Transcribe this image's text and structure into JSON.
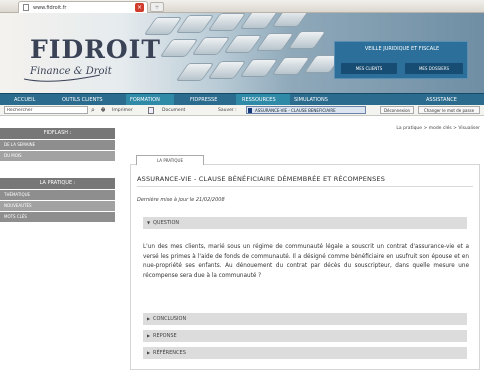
{
  "browser": {
    "tab_title": "www.fidroit.fr"
  },
  "brand": {
    "logo": "FIDROIT",
    "tagline": "Finance & Droit"
  },
  "veille": {
    "title": "VEILLE JURIDIQUE ET FISCALE",
    "btn_clients": "MES CLIENTS",
    "btn_dossiers": "MES DOSSIERS"
  },
  "nav": {
    "accueil": "ACCUEIL",
    "outils": "OUTILS CLIENTS",
    "formation": "FORMATION",
    "fidpresse": "FIDPRESSE",
    "ressources": "RESSOURCES",
    "simulations": "SIMULATIONS",
    "assistance": "ASSISTANCE"
  },
  "toolbar": {
    "search_value": "Rechercher",
    "imprimer": "Imprimer",
    "document": "Document",
    "sauver": "Sauver :",
    "sauver_value": "ASSURANCE-VIE - CLAUSE BENEFICIAIRE",
    "deconnexion": "Déconnexion",
    "changer": "Changer le mot de passe"
  },
  "sidebar": {
    "flash_title": "FIDFLASH :",
    "flash_items": [
      "DE LA SEMAINE",
      "DU MOIS"
    ],
    "pratique_title": "LA PRATIQUE :",
    "pratique_items": [
      "THÉMATIQUE",
      "NOUVEAUTÉS",
      "MOTS CLÉS"
    ]
  },
  "breadcrumb": "La pratique > mode clés > Visualiser",
  "content_tab": "LA PRATIQUE",
  "article": {
    "title": "ASSURANCE-VIE - CLAUSE BÉNÉFICIAIRE DÉMEMBRÉE ET RÉCOMPENSES",
    "date": "Dernière mise à jour le 21/02/2008",
    "sections": {
      "question": "QUESTION",
      "conclusion": "CONCLUSION",
      "reponse": "REPONSE",
      "references": "RÉFÉRENCES"
    },
    "question_text": "L'un des mes clients, marié sous un régime de communauté légale a souscrit un contrat d'assurance-vie et a versé les primes à l'aide de fonds de communauté. Il a désigné comme bénéficiaire en usufruit son épouse et en nue-propriété ses enfants. Au dénouement du contrat par décès du souscripteur, dans quelle mesure une récompense sera due à la communauté ?"
  },
  "icons": {
    "arrow_open": "▼",
    "arrow_closed": "▶"
  },
  "colors": {
    "nav": "#2a6b8e",
    "veille_box": "#2b6f9a",
    "sidebar_head": "#777777",
    "accordion": "#dcdcdc"
  }
}
